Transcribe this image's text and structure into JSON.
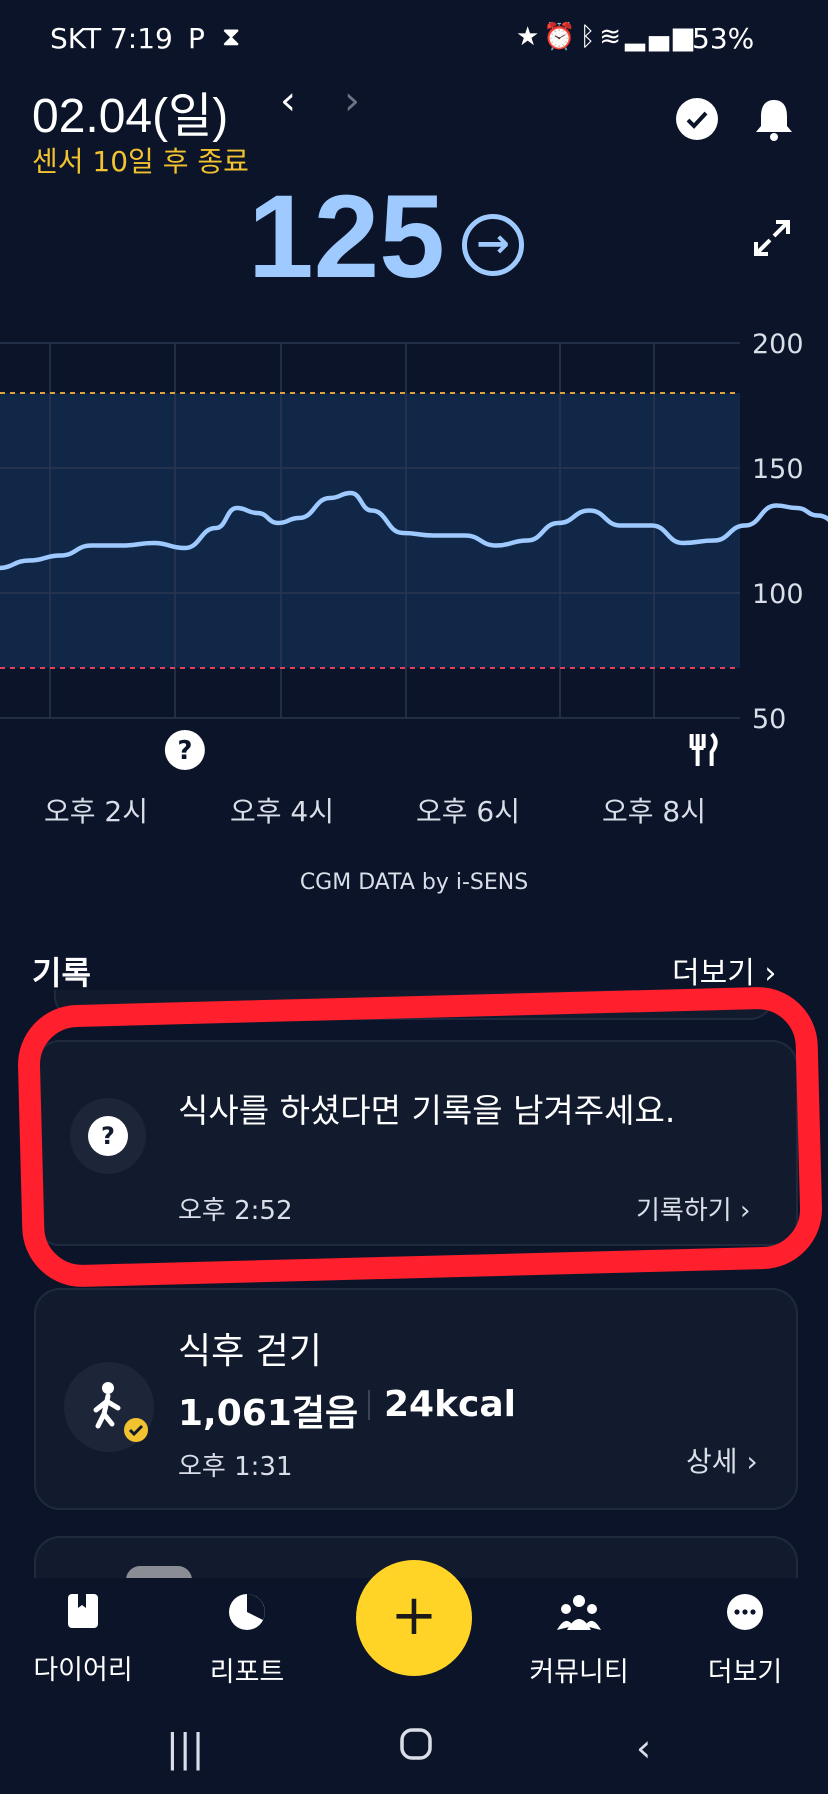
{
  "status_bar": {
    "carrier_time": "SKT 7:19",
    "notification_icons": [
      "parking-icon",
      "hourglass-icon"
    ],
    "system_icons": [
      "star-icon",
      "alarm-icon",
      "bluetooth-icon",
      "wifi-icon",
      "signal-icon"
    ],
    "battery": "53%"
  },
  "header": {
    "date": "02.04(일)",
    "prev_label": "‹",
    "next_label": "›",
    "sensor_notice": "센서 10일 후 종료",
    "glucose_value": "125",
    "trend_arrow": "→"
  },
  "chart_data": {
    "type": "line",
    "y_ticks": [
      "200",
      "150",
      "100",
      "50"
    ],
    "ylim": [
      50,
      200
    ],
    "target_range": {
      "high": 180,
      "low": 70
    },
    "x_ticks": [
      "오후 2시",
      "오후 4시",
      "오후 6시",
      "오후 8시"
    ],
    "series": [
      {
        "values": [
          {
            "t": "13:20",
            "v": 103
          },
          {
            "t": "13:35",
            "v": 110
          },
          {
            "t": "13:50",
            "v": 113
          },
          {
            "t": "14:05",
            "v": 115
          },
          {
            "t": "14:20",
            "v": 119
          },
          {
            "t": "14:35",
            "v": 119
          },
          {
            "t": "14:50",
            "v": 120
          },
          {
            "t": "15:05",
            "v": 118
          },
          {
            "t": "15:20",
            "v": 126
          },
          {
            "t": "15:30",
            "v": 134
          },
          {
            "t": "15:40",
            "v": 132
          },
          {
            "t": "15:50",
            "v": 128
          },
          {
            "t": "16:00",
            "v": 130
          },
          {
            "t": "16:15",
            "v": 138
          },
          {
            "t": "16:25",
            "v": 140
          },
          {
            "t": "16:35",
            "v": 133
          },
          {
            "t": "16:50",
            "v": 124
          },
          {
            "t": "17:05",
            "v": 123
          },
          {
            "t": "17:20",
            "v": 123
          },
          {
            "t": "17:35",
            "v": 119
          },
          {
            "t": "17:50",
            "v": 121
          },
          {
            "t": "18:05",
            "v": 128
          },
          {
            "t": "18:20",
            "v": 133
          },
          {
            "t": "18:35",
            "v": 127
          },
          {
            "t": "18:50",
            "v": 127
          },
          {
            "t": "19:05",
            "v": 120
          },
          {
            "t": "19:20",
            "v": 121
          },
          {
            "t": "19:35",
            "v": 127
          },
          {
            "t": "19:50",
            "v": 135
          },
          {
            "t": "20:00",
            "v": 134
          },
          {
            "t": "20:10",
            "v": 131
          },
          {
            "t": "20:25",
            "v": 124
          }
        ]
      }
    ],
    "events": [
      {
        "t": "13:25",
        "icon": "meal-icon"
      },
      {
        "t": "15:05",
        "icon": "question-icon"
      },
      {
        "t": "19:15",
        "icon": "meal-icon"
      }
    ]
  },
  "credit": "CGM DATA by i-SENS",
  "records": {
    "title": "기록",
    "more_label": "더보기",
    "meal_prompt": {
      "message": "식사를 하셨다면 기록을 남겨주세요.",
      "time": "오후 2:52",
      "action": "기록하기"
    },
    "walk": {
      "title": "식후 걷기",
      "steps": "1,061걸음",
      "kcal": "24kcal",
      "time": "오후 1:31",
      "action": "상세"
    }
  },
  "bottom_nav": [
    {
      "label": "다이어리",
      "icon": "diary-icon"
    },
    {
      "label": "리포트",
      "icon": "report-icon"
    },
    {
      "label": "커뮤니티",
      "icon": "community-icon"
    },
    {
      "label": "더보기",
      "icon": "more-icon"
    }
  ],
  "fab_label": "+",
  "colors": {
    "background": "#0b1428",
    "glucose": "#9fcaff",
    "accent": "#ffd426",
    "sensor_notice": "#f2c230",
    "high_limit": "#e0a03a",
    "low_limit": "#e0405a",
    "annotation_red": "#ff1f2d"
  }
}
